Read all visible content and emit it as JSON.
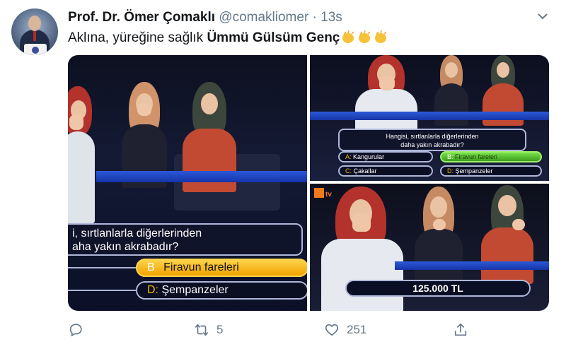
{
  "tweet": {
    "author_name": "Prof. Dr. Ömer Çomaklı",
    "handle": "@comakliomer",
    "separator": "·",
    "time": "13s",
    "text_prefix": "Aklına, yüreğine sağlık ",
    "text_bold": "Ümmü Gülsüm Genç",
    "emoji": [
      "clapping-hands",
      "clapping-hands",
      "clapping-hands"
    ]
  },
  "media": {
    "panel1": {
      "question_line1": "i, sırtlanlarla diğerlerinden",
      "question_line2": "aha yakın akrabadır?",
      "answer_b_key": "B",
      "answer_b": "Firavun fareleri",
      "answer_d_key": "D:",
      "answer_d": "Şempanzeler"
    },
    "panel2": {
      "question_line1": "Hangisi, sırtlanlarla diğerlerinden",
      "question_line2": "daha yakın akrabadır?",
      "answer_a_key": "A:",
      "answer_a": "Kangurular",
      "answer_b_key": "B:",
      "answer_b": "Firavun fareleri",
      "answer_c_key": "C:",
      "answer_c": "Çakallar",
      "answer_d_key": "D:",
      "answer_d": "Şempanzeler"
    },
    "panel3": {
      "channel": "tv",
      "prize": "125.000 TL"
    }
  },
  "actions": {
    "reply_count": "",
    "retweet_count": "5",
    "like_count": "251"
  },
  "colors": {
    "text": "#14171a",
    "muted": "#657786",
    "selected_answer": "#f0a200",
    "correct_answer": "#3c9d1c",
    "stage_blue": "#1634a8"
  }
}
